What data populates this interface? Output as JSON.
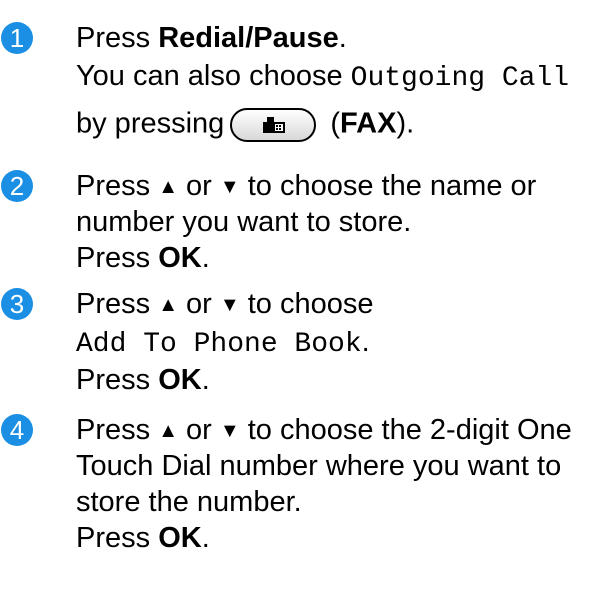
{
  "accent_color": "#1a8fe3",
  "steps": [
    {
      "number": "1",
      "line1_prefix": "Press ",
      "line1_bold": "Redial/Pause",
      "line1_suffix": ".",
      "line2_text": "You can also choose ",
      "line2_mono": "Outgoing Call",
      "line3_prefix": "by pressing",
      "fax_icon": "fax-button-icon",
      "line3_open": " (",
      "line3_bold": "FAX",
      "line3_close": ")."
    },
    {
      "number": "2",
      "line1_prefix": "Press ",
      "up_arrow": "▲",
      "or_text": " or ",
      "down_arrow": "▼",
      "line1_suffix": " to choose the name or",
      "line2_text": "number you want to store.",
      "line3_prefix": "Press ",
      "line3_bold": "OK",
      "line3_suffix": "."
    },
    {
      "number": "3",
      "line1_prefix": "Press ",
      "up_arrow": "▲",
      "or_text": " or ",
      "down_arrow": "▼",
      "line1_suffix": " to choose",
      "line2_mono": "Add To Phone Book",
      "line2_suffix": ".",
      "line3_prefix": "Press ",
      "line3_bold": "OK",
      "line3_suffix": "."
    },
    {
      "number": "4",
      "line1_prefix": "Press ",
      "up_arrow": "▲",
      "or_text": " or ",
      "down_arrow": "▼",
      "line1_suffix": " to choose the 2-digit One",
      "line2_text": "Touch Dial number where you want to",
      "line3_text": "store the number.",
      "line4_prefix": "Press ",
      "line4_bold": "OK",
      "line4_suffix": "."
    }
  ]
}
